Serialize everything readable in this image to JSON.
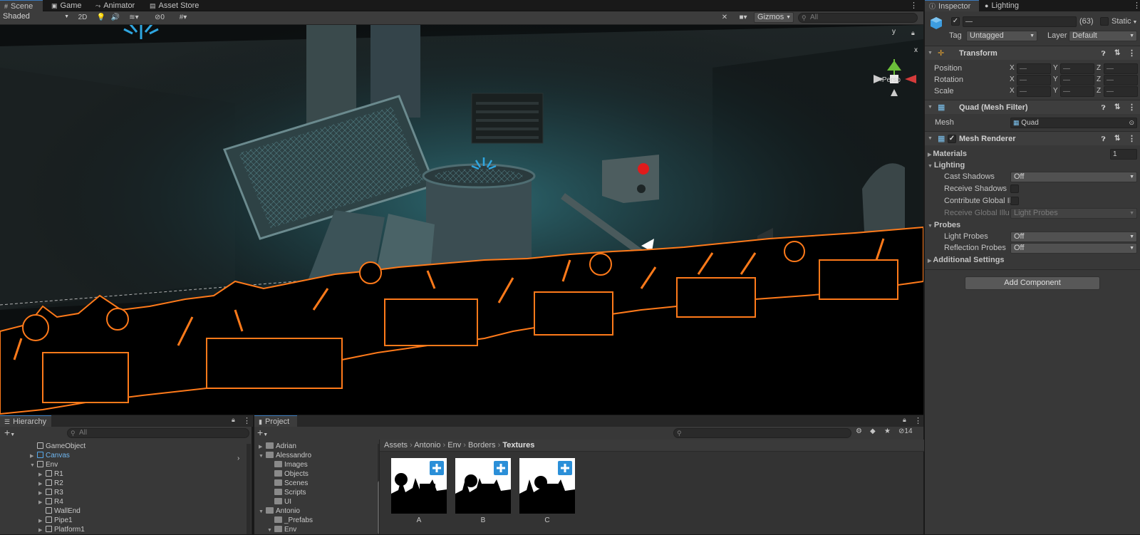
{
  "scene_tabs": [
    {
      "label": "Scene",
      "icon": "grid-icon"
    },
    {
      "label": "Game",
      "icon": "gamepad-icon"
    },
    {
      "label": "Animator",
      "icon": "animator-icon"
    },
    {
      "label": "Asset Store",
      "icon": "store-icon"
    }
  ],
  "scene_toolbar": {
    "shading_mode": "Shaded",
    "mode_2d": "2D",
    "hidden_count": "0",
    "gizmos_label": "Gizmos",
    "search_placeholder": "All"
  },
  "scene_view": {
    "projection": "Persp",
    "axis_y": "y",
    "axis_x": "x",
    "outline_color": "#ff7a1a",
    "sky_color": "#000000"
  },
  "inspector_tabs": [
    {
      "label": "Inspector",
      "icon": "info-icon"
    },
    {
      "label": "Lighting",
      "icon": "bulb-icon"
    }
  ],
  "inspector": {
    "object_name": "—",
    "count": "(63)",
    "static_label": "Static",
    "tag_label": "Tag",
    "tag_value": "Untagged",
    "layer_label": "Layer",
    "layer_value": "Default",
    "transform": {
      "title": "Transform",
      "rows": [
        {
          "label": "Position",
          "x": "—",
          "y": "—",
          "z": "—"
        },
        {
          "label": "Rotation",
          "x": "—",
          "y": "—",
          "z": "—"
        },
        {
          "label": "Scale",
          "x": "—",
          "y": "—",
          "z": "—"
        }
      ],
      "axis_x": "X",
      "axis_y": "Y",
      "axis_z": "Z"
    },
    "mesh_filter": {
      "title": "Quad (Mesh Filter)",
      "mesh_label": "Mesh",
      "mesh_value": "Quad"
    },
    "mesh_renderer": {
      "title": "Mesh Renderer",
      "materials_label": "Materials",
      "materials_count": "1",
      "lighting_label": "Lighting",
      "cast_shadows_label": "Cast Shadows",
      "cast_shadows_value": "Off",
      "receive_shadows_label": "Receive Shadows",
      "contribute_gi_label": "Contribute Global Il",
      "receive_gi_label": "Receive Global Illur",
      "receive_gi_value": "Light Probes",
      "probes_label": "Probes",
      "light_probes_label": "Light Probes",
      "light_probes_value": "Off",
      "reflection_probes_label": "Reflection Probes",
      "reflection_probes_value": "Off",
      "additional_label": "Additional Settings"
    },
    "add_component": "Add Component"
  },
  "hierarchy": {
    "title": "Hierarchy",
    "add": "+",
    "search_placeholder": "All",
    "items": [
      {
        "label": "GameObject",
        "indent": 0,
        "arrow": "",
        "highlight": false
      },
      {
        "label": "Canvas",
        "indent": 0,
        "arrow": "▶",
        "highlight": true
      },
      {
        "label": "Env",
        "indent": 0,
        "arrow": "▼",
        "highlight": false
      },
      {
        "label": "R1",
        "indent": 1,
        "arrow": "▶",
        "highlight": false
      },
      {
        "label": "R2",
        "indent": 1,
        "arrow": "▶",
        "highlight": false
      },
      {
        "label": "R3",
        "indent": 1,
        "arrow": "▶",
        "highlight": false
      },
      {
        "label": "R4",
        "indent": 1,
        "arrow": "▶",
        "highlight": false
      },
      {
        "label": "WallEnd",
        "indent": 1,
        "arrow": "",
        "highlight": false
      },
      {
        "label": "Pipe1",
        "indent": 1,
        "arrow": "▶",
        "highlight": false
      },
      {
        "label": "Platform1",
        "indent": 1,
        "arrow": "▶",
        "highlight": false
      }
    ]
  },
  "project": {
    "title": "Project",
    "add": "+",
    "hidden_count": "14",
    "tree": [
      {
        "label": "Adrian",
        "indent": 0,
        "arrow": "▶"
      },
      {
        "label": "Alessandro",
        "indent": 0,
        "arrow": "▼"
      },
      {
        "label": "Images",
        "indent": 1,
        "arrow": ""
      },
      {
        "label": "Objects",
        "indent": 1,
        "arrow": ""
      },
      {
        "label": "Scenes",
        "indent": 1,
        "arrow": ""
      },
      {
        "label": "Scripts",
        "indent": 1,
        "arrow": ""
      },
      {
        "label": "UI",
        "indent": 1,
        "arrow": ""
      },
      {
        "label": "Antonio",
        "indent": 0,
        "arrow": "▼"
      },
      {
        "label": "_Prefabs",
        "indent": 1,
        "arrow": ""
      },
      {
        "label": "Env",
        "indent": 1,
        "arrow": "▼"
      }
    ],
    "breadcrumb": [
      "Assets",
      "Antonio",
      "Env",
      "Borders",
      "Textures"
    ],
    "assets": [
      {
        "label": "A"
      },
      {
        "label": "B"
      },
      {
        "label": "C"
      }
    ]
  }
}
